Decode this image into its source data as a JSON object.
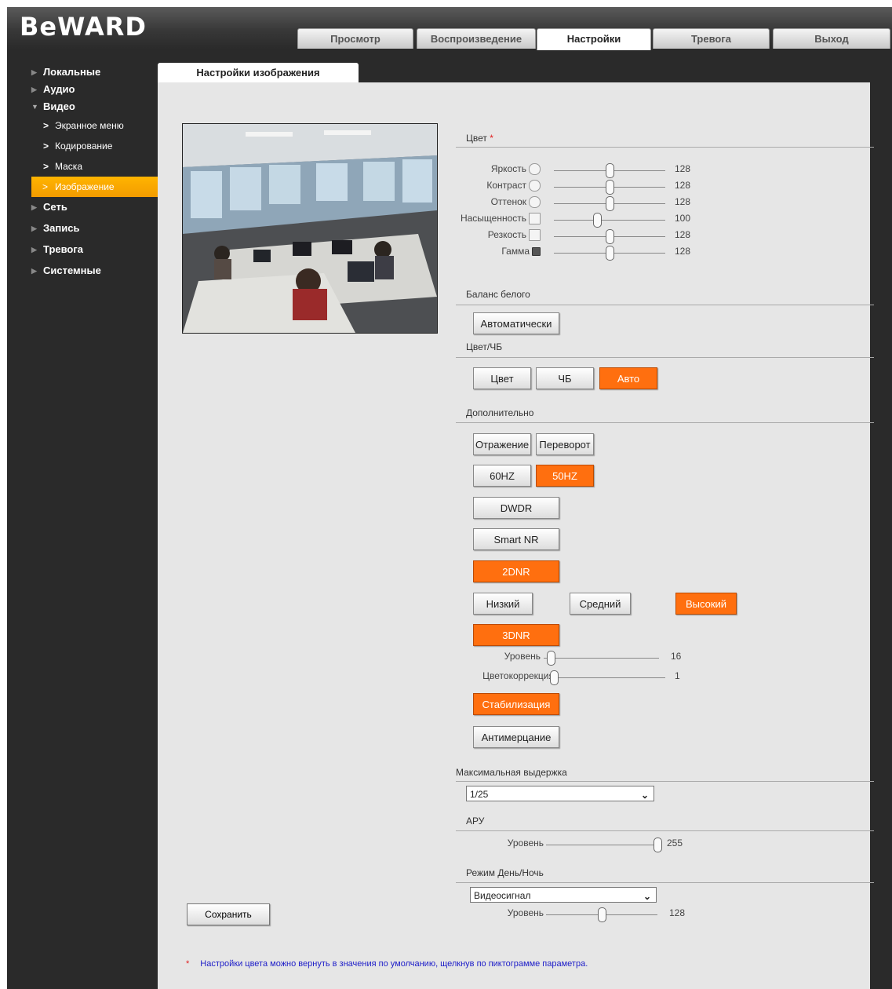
{
  "brand": "BeWARD",
  "tabs": [
    "Просмотр",
    "Воспроизведение",
    "Настройки",
    "Тревога",
    "Выход"
  ],
  "sidebar": {
    "items": [
      "Локальные",
      "Аудио",
      "Видео"
    ],
    "video_sub": [
      "Экранное меню",
      "Кодирование",
      "Маска",
      "Изображение"
    ],
    "items_after": [
      "Сеть",
      "Запись",
      "Тревога",
      "Системные"
    ]
  },
  "content_tab": "Настройки изображения",
  "color": {
    "title": "Цвет",
    "asterisk": "*",
    "sliders": [
      {
        "label": "Яркость",
        "value": "128",
        "level": 0.5,
        "icon": "sun-icon"
      },
      {
        "label": "Контраст",
        "value": "128",
        "level": 0.5,
        "icon": "contrast-icon"
      },
      {
        "label": "Оттенок",
        "value": "128",
        "level": 0.5,
        "icon": "palette-icon"
      },
      {
        "label": "Насыщенность",
        "value": "100",
        "level": 0.39,
        "icon": "brush-icon"
      },
      {
        "label": "Резкость",
        "value": "128",
        "level": 0.5,
        "icon": "sharpness-icon"
      },
      {
        "label": "Гамма",
        "value": "128",
        "level": 0.5,
        "icon": "gamma-icon"
      }
    ]
  },
  "wb": {
    "title": "Баланс белого",
    "button": "Автоматически"
  },
  "colorbw": {
    "title": "Цвет/ЧБ",
    "buttons": [
      "Цвет",
      "ЧБ",
      "Авто"
    ],
    "active": "Авто"
  },
  "extra": {
    "title": "Дополнительно",
    "mirror": "Отражение",
    "flip": "Переворот",
    "hz60": "60HZ",
    "hz50": "50HZ",
    "dwdr": "DWDR",
    "smartnr": "Smart NR",
    "dnr2": "2DNR",
    "low": "Низкий",
    "mid": "Средний",
    "high": "Высокий",
    "dnr3": "3DNR",
    "level_label": "Уровень",
    "level_value": "16",
    "level_pos": 0.06,
    "colorcorr_label": "Цветокоррекция",
    "colorcorr_value": "1",
    "colorcorr_pos": 0.0,
    "stab": "Стабилизация",
    "antiflicker": "Антимерцание"
  },
  "shutter": {
    "title": "Максимальная выдержка",
    "value": "1/25"
  },
  "agc": {
    "title": "АРУ",
    "label": "Уровень",
    "value": "255",
    "level": 1.0
  },
  "daynight": {
    "title": "Режим День/Ночь",
    "value": "Видеосигнал",
    "label": "Уровень",
    "level_value": "128",
    "level": 0.5
  },
  "save": "Сохранить",
  "note": {
    "star": "*",
    "text": "Настройки цвета можно вернуть в значения по умолчанию, щелкнув по пиктограмме параметра."
  },
  "colors": {
    "accent": "#ff6f0f",
    "active_menu": "#f5a300",
    "bg_dark": "#2a2a2a",
    "panel": "#e6e6e6"
  }
}
